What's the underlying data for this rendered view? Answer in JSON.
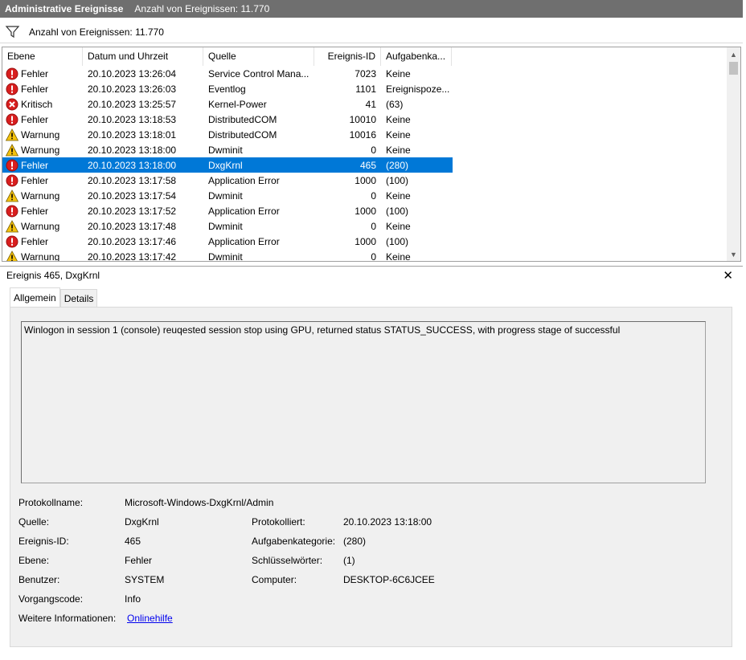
{
  "title": {
    "name": "Administrative Ereignisse",
    "count": "Anzahl von Ereignissen: 11.770"
  },
  "filter": {
    "icon": "filter-icon",
    "text": "Anzahl von Ereignissen: 11.770"
  },
  "columns": [
    "Ebene",
    "Datum und Uhrzeit",
    "Quelle",
    "Ereignis-ID",
    "Aufgabenka..."
  ],
  "events": [
    {
      "level": "Fehler",
      "icon": "error",
      "date": "20.10.2023 13:26:04",
      "source": "Service Control Mana...",
      "id": "7023",
      "task": "Keine"
    },
    {
      "level": "Fehler",
      "icon": "error",
      "date": "20.10.2023 13:26:03",
      "source": "Eventlog",
      "id": "1101",
      "task": "Ereignispoze..."
    },
    {
      "level": "Kritisch",
      "icon": "critical",
      "date": "20.10.2023 13:25:57",
      "source": "Kernel-Power",
      "id": "41",
      "task": "(63)"
    },
    {
      "level": "Fehler",
      "icon": "error",
      "date": "20.10.2023 13:18:53",
      "source": "DistributedCOM",
      "id": "10010",
      "task": "Keine"
    },
    {
      "level": "Warnung",
      "icon": "warning",
      "date": "20.10.2023 13:18:01",
      "source": "DistributedCOM",
      "id": "10016",
      "task": "Keine"
    },
    {
      "level": "Warnung",
      "icon": "warning",
      "date": "20.10.2023 13:18:00",
      "source": "Dwminit",
      "id": "0",
      "task": "Keine"
    },
    {
      "level": "Fehler",
      "icon": "error",
      "date": "20.10.2023 13:18:00",
      "source": "DxgKrnl",
      "id": "465",
      "task": "(280)",
      "selected": true
    },
    {
      "level": "Fehler",
      "icon": "error",
      "date": "20.10.2023 13:17:58",
      "source": "Application Error",
      "id": "1000",
      "task": "(100)"
    },
    {
      "level": "Warnung",
      "icon": "warning",
      "date": "20.10.2023 13:17:54",
      "source": "Dwminit",
      "id": "0",
      "task": "Keine"
    },
    {
      "level": "Fehler",
      "icon": "error",
      "date": "20.10.2023 13:17:52",
      "source": "Application Error",
      "id": "1000",
      "task": "(100)"
    },
    {
      "level": "Warnung",
      "icon": "warning",
      "date": "20.10.2023 13:17:48",
      "source": "Dwminit",
      "id": "0",
      "task": "Keine"
    },
    {
      "level": "Fehler",
      "icon": "error",
      "date": "20.10.2023 13:17:46",
      "source": "Application Error",
      "id": "1000",
      "task": "(100)"
    },
    {
      "level": "Warnung",
      "icon": "warning",
      "date": "20.10.2023 13:17:42",
      "source": "Dwminit",
      "id": "0",
      "task": "Keine"
    }
  ],
  "detail": {
    "header": "Ereignis 465, DxgKrnl",
    "close": "✕",
    "tabs": [
      "Allgemein",
      "Details"
    ],
    "message": "Winlogon in session 1 (console) reuqested session stop using GPU, returned status STATUS_SUCCESS, with progress stage of successful",
    "labels": {
      "log": "Protokollname:",
      "source": "Quelle:",
      "id": "Ereignis-ID:",
      "level": "Ebene:",
      "user": "Benutzer:",
      "opcode": "Vorgangscode:",
      "more": "Weitere Informationen:",
      "logged": "Protokolliert:",
      "task": "Aufgabenkategorie:",
      "keywords": "Schlüsselwörter:",
      "computer": "Computer:"
    },
    "values": {
      "log": "Microsoft-Windows-DxgKrnl/Admin",
      "source": "DxgKrnl",
      "id": "465",
      "level": "Fehler",
      "user": "SYSTEM",
      "opcode": "Info",
      "more": "Onlinehilfe",
      "logged": "20.10.2023 13:18:00",
      "task": "(280)",
      "keywords": "(1)",
      "computer": "DESKTOP-6C6JCEE"
    }
  },
  "colors": {
    "selection": "#0078d7",
    "error": "#d81e1e",
    "warning": "#f4c20d",
    "titlebar": "#6f6f6f"
  }
}
